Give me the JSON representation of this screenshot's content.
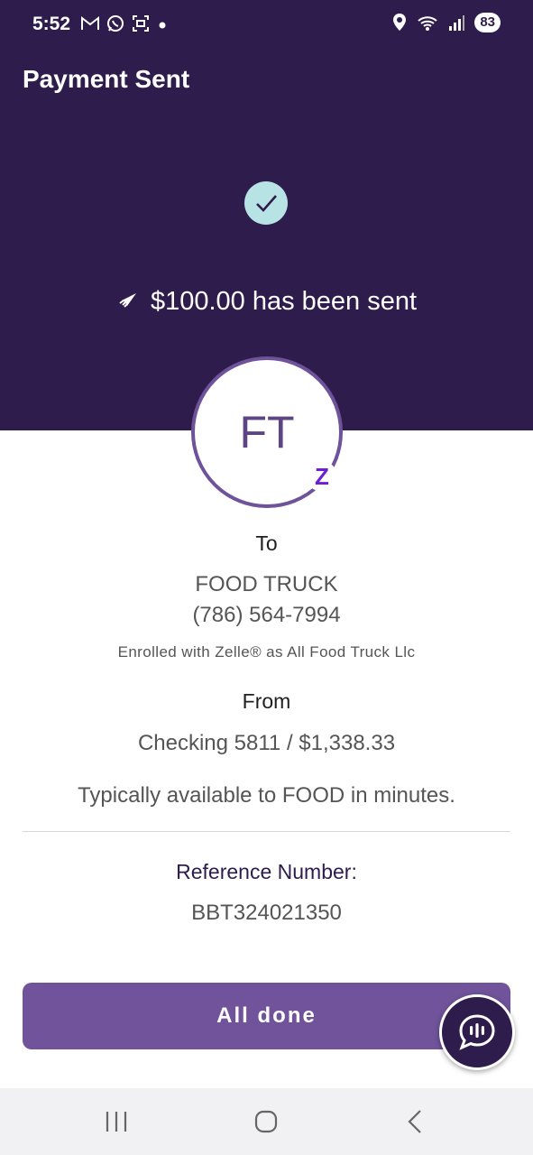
{
  "status_bar": {
    "time": "5:52",
    "battery": "83",
    "left_icons": [
      "gmail-icon",
      "whatsapp-icon",
      "screenshot-icon",
      "dot-icon"
    ],
    "right_icons": [
      "location-icon",
      "wifi-icon",
      "signal-icon",
      "battery-icon"
    ]
  },
  "header": {
    "title": "Payment Sent",
    "sent_message": "$100.00 has been sent",
    "background_color": "#2e1c4c"
  },
  "recipient": {
    "initials": "FT",
    "to_label": "To",
    "name": "FOOD TRUCK",
    "phone": "(786) 564-7994",
    "enrolled_text": "Enrolled with Zelle® as All Food Truck Llc"
  },
  "source": {
    "from_label": "From",
    "account": "Checking 5811 / $1,338.33",
    "availability": "Typically available to FOOD in minutes."
  },
  "reference": {
    "label": "Reference Number:",
    "number": "BBT324021350"
  },
  "actions": {
    "done_label": "All done",
    "accent_color": "#70539a"
  },
  "nav": {
    "icons": [
      "recent-apps-icon",
      "home-icon",
      "back-icon"
    ]
  }
}
